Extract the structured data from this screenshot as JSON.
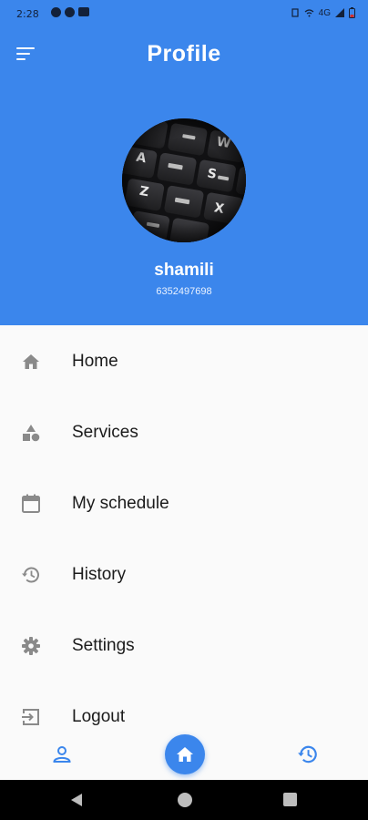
{
  "status_bar": {
    "time": "2:28",
    "network": "4G"
  },
  "header": {
    "title": "Profile",
    "menu_icon": "menu-icon",
    "background_color": "#3b86ec"
  },
  "profile": {
    "name": "shamili",
    "phone": "6352497698",
    "avatar_keys": [
      "W",
      "A",
      "S",
      "Z",
      "X"
    ]
  },
  "menu": {
    "items": [
      {
        "label": "Home",
        "icon": "home-icon"
      },
      {
        "label": "Services",
        "icon": "services-icon"
      },
      {
        "label": "My schedule",
        "icon": "calendar-icon"
      },
      {
        "label": "History",
        "icon": "history-icon"
      },
      {
        "label": "Settings",
        "icon": "gear-icon"
      },
      {
        "label": "Logout",
        "icon": "logout-icon"
      }
    ]
  },
  "bottom_nav": {
    "items": [
      "person-icon",
      "home-icon",
      "history-icon"
    ],
    "active": "home",
    "accent": "#3b86ec"
  }
}
